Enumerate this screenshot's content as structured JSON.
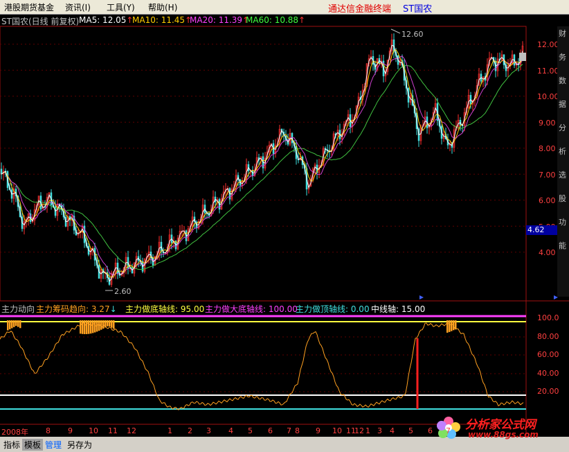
{
  "menu": {
    "items": [
      "港股期货基金",
      "资讯(I)",
      "工具(Y)",
      "帮助(H)"
    ],
    "brand": "通达信金融终端",
    "stock_name": "ST国农"
  },
  "main_header": {
    "title": "ST国农(日线 前复权)",
    "ma5": "MA5: 12.05",
    "ma10": "MA10: 11.45",
    "ma20": "MA20: 11.39",
    "ma60": "MA60: 10.88",
    "arrow": "↑"
  },
  "price_axis": [
    "12.00",
    "11.00",
    "10.00",
    "9.00",
    "8.00",
    "7.00",
    "6.00",
    "5.00",
    "4.00"
  ],
  "price_marker": "4.62",
  "price_annotations": {
    "high": "12.60",
    "low": "2.60"
  },
  "indicator_header": {
    "name": "主力动向",
    "trend_label": "主力筹码趋向: 3.27",
    "trend_arrow": "↓",
    "bottom_line": "主力做底轴线: 95.00",
    "big_bottom": "主力做大底轴线: 100.00",
    "top_line": "主力做顶轴线: 0.00",
    "mid_line": "中线轴: 15.00"
  },
  "indicator_axis": [
    "100.0",
    "80.00",
    "60.00",
    "40.00",
    "20.00"
  ],
  "time_axis": [
    "2008年",
    "8",
    "9",
    "10",
    "11",
    "12",
    "1",
    "2",
    "3",
    "4",
    "5",
    "6",
    "7",
    "8",
    "9",
    "10",
    "11",
    "12",
    "1",
    "3",
    "4",
    "5",
    "6",
    "7"
  ],
  "bottom_tabs": [
    "指标",
    "模板",
    "管理",
    "另存为"
  ],
  "right_strip": "财务数据分析选股功能",
  "logo": {
    "text": "分析家公式网",
    "url": "www.88gs.com"
  },
  "colors": {
    "ma5": "#ffffff",
    "ma10": "#ffcc00",
    "ma20": "#ff40ff",
    "ma60": "#40ff40",
    "up": "#ff3030",
    "down": "#40e0e0",
    "indicator": "#ffa020"
  }
}
